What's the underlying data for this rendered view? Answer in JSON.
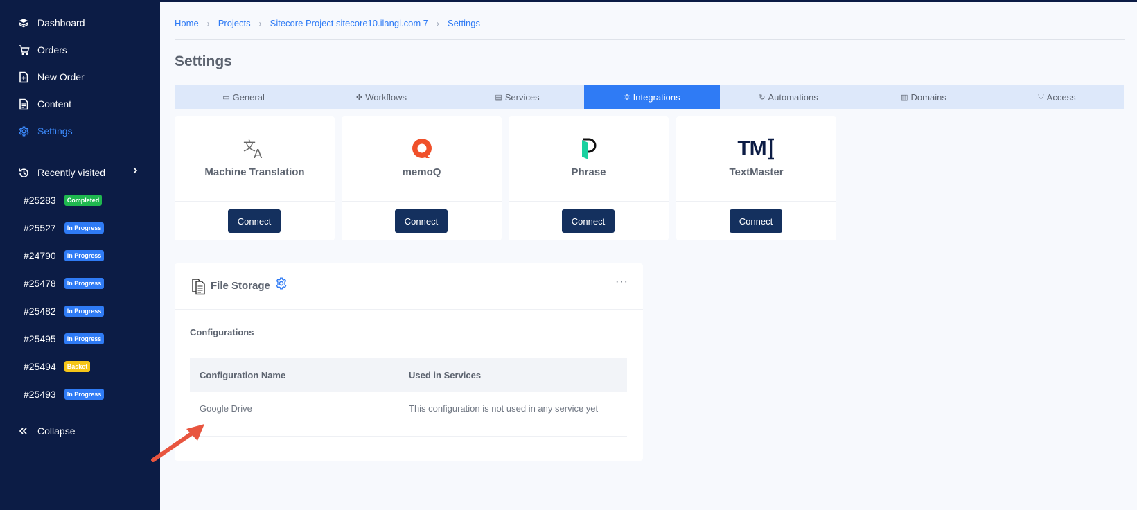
{
  "sidebar": {
    "nav": [
      {
        "label": "Dashboard",
        "icon": "layers-icon"
      },
      {
        "label": "Orders",
        "icon": "cart-icon"
      },
      {
        "label": "New Order",
        "icon": "file-plus-icon"
      },
      {
        "label": "Content",
        "icon": "document-icon"
      },
      {
        "label": "Settings",
        "icon": "gear-icon"
      }
    ],
    "recently_visited_label": "Recently visited",
    "recent": [
      {
        "id": "#25283",
        "status": "Completed"
      },
      {
        "id": "#25527",
        "status": "In Progress"
      },
      {
        "id": "#24790",
        "status": "In Progress"
      },
      {
        "id": "#25478",
        "status": "In Progress"
      },
      {
        "id": "#25482",
        "status": "In Progress"
      },
      {
        "id": "#25495",
        "status": "In Progress"
      },
      {
        "id": "#25494",
        "status": "Basket"
      },
      {
        "id": "#25493",
        "status": "In Progress"
      }
    ],
    "collapse_label": "Collapse"
  },
  "breadcrumb": [
    "Home",
    "Projects",
    "Sitecore Project sitecore10.ilangl.com 7",
    "Settings"
  ],
  "page_title": "Settings",
  "tabs": [
    {
      "label": "General",
      "icon": "window-icon"
    },
    {
      "label": "Workflows",
      "icon": "workflow-icon"
    },
    {
      "label": "Services",
      "icon": "server-icon"
    },
    {
      "label": "Integrations",
      "icon": "puzzle-icon"
    },
    {
      "label": "Automations",
      "icon": "refresh-icon"
    },
    {
      "label": "Domains",
      "icon": "building-icon"
    },
    {
      "label": "Access",
      "icon": "shield-icon"
    }
  ],
  "integrations": [
    {
      "name": "Machine Translation",
      "button": "Connect"
    },
    {
      "name": "memoQ",
      "button": "Connect"
    },
    {
      "name": "Phrase",
      "button": "Connect"
    },
    {
      "name": "TextMaster",
      "button": "Connect",
      "logo_text": "TM"
    }
  ],
  "file_storage": {
    "title": "File Storage",
    "more": "···",
    "subtitle": "Configurations",
    "columns": [
      "Configuration Name",
      "Used in Services"
    ],
    "rows": [
      {
        "name": "Google Drive",
        "used": "This configuration is not used in any service yet"
      }
    ]
  },
  "colors": {
    "sidebar_bg": "#0c1c45",
    "accent": "#2f7bf5",
    "button_bg": "#14305e",
    "annotation_arrow": "#e8553f"
  }
}
